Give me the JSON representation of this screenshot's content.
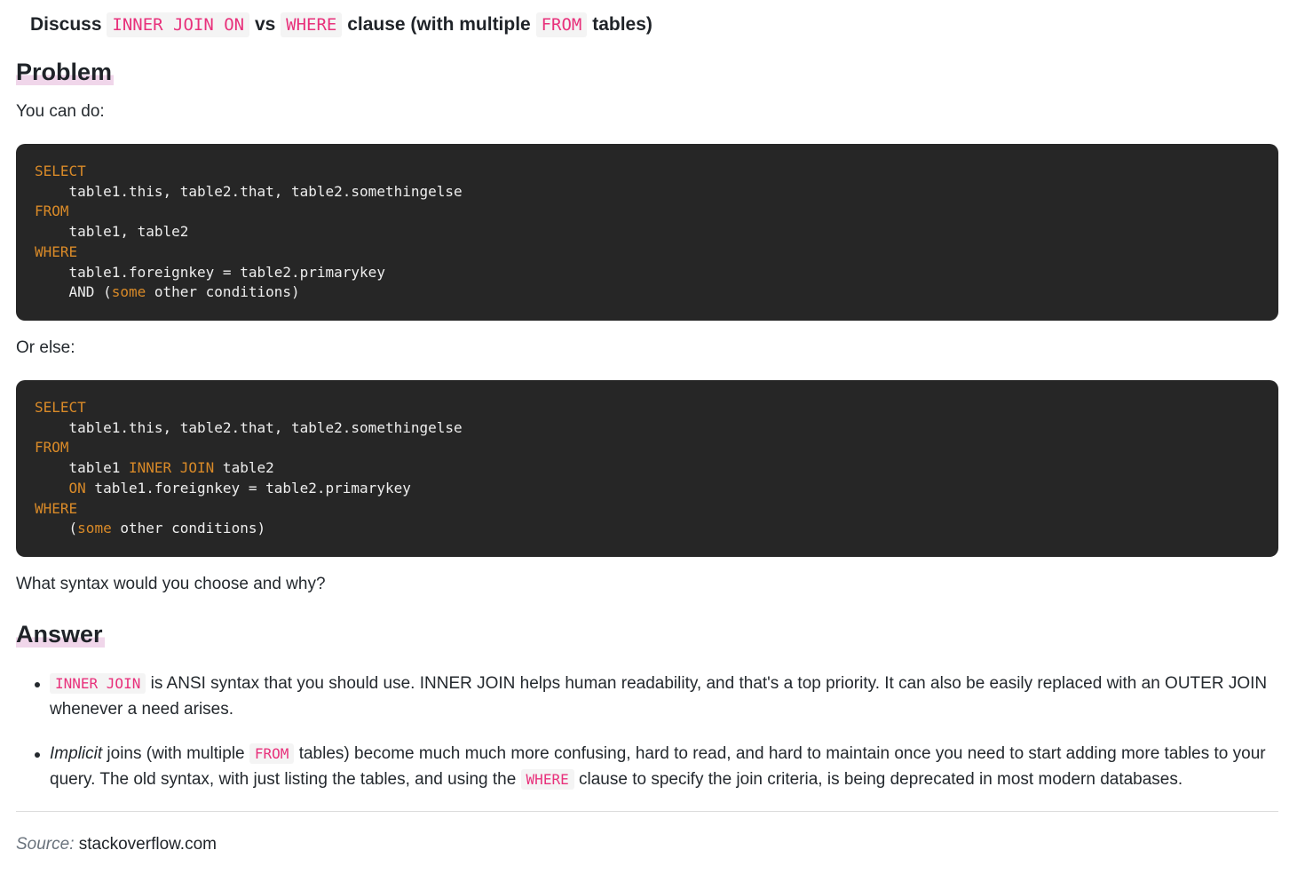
{
  "title": {
    "w1": "Discuss",
    "c1": "INNER JOIN ON",
    "w2": "vs",
    "c2": "WHERE",
    "w3": "clause (with multiple",
    "c3": "FROM",
    "w4": "tables)"
  },
  "problem": {
    "heading": "Problem",
    "intro": "You can do:",
    "or_else": "Or else:",
    "question": "What syntax would you choose and why?"
  },
  "code1": {
    "select": "SELECT",
    "select_line": "    table1.this, table2.that, table2.somethingelse",
    "from": "FROM",
    "from_line": "    table1, table2",
    "where": "WHERE",
    "where_line1": "    table1.foreignkey = table2.primarykey",
    "where_line2_pre": "    AND (",
    "where_line2_kw": "some",
    "where_line2_post": " other conditions)"
  },
  "code2": {
    "select": "SELECT",
    "select_line": "    table1.this, table2.that, table2.somethingelse",
    "from": "FROM",
    "from_line_pre": "    table1 ",
    "from_line_kw": "INNER JOIN",
    "from_line_post": " table2",
    "on_indent": "    ",
    "on_kw": "ON",
    "on_post": " table1.foreignkey = table2.primarykey",
    "where": "WHERE",
    "where_line_pre": "    (",
    "where_line_kw": "some",
    "where_line_post": " other conditions)"
  },
  "answer": {
    "heading": "Answer",
    "item1": {
      "code": "INNER JOIN",
      "text": " is ANSI syntax that you should use. INNER JOIN helps human readability, and that's a top priority. It can also be easily replaced with an OUTER JOIN whenever a need arises."
    },
    "item2": {
      "em": "Implicit",
      "text1": " joins (with multiple ",
      "code1": "FROM",
      "text2": " tables) become much much more confusing, hard to read, and hard to maintain once you need to start adding more tables to your query. The old syntax, with just listing the tables, and using the ",
      "code2": "WHERE",
      "text3": " clause to specify the join criteria, is being deprecated in most modern databases."
    }
  },
  "source": {
    "label": "Source:",
    "value": "stackoverflow.com"
  }
}
